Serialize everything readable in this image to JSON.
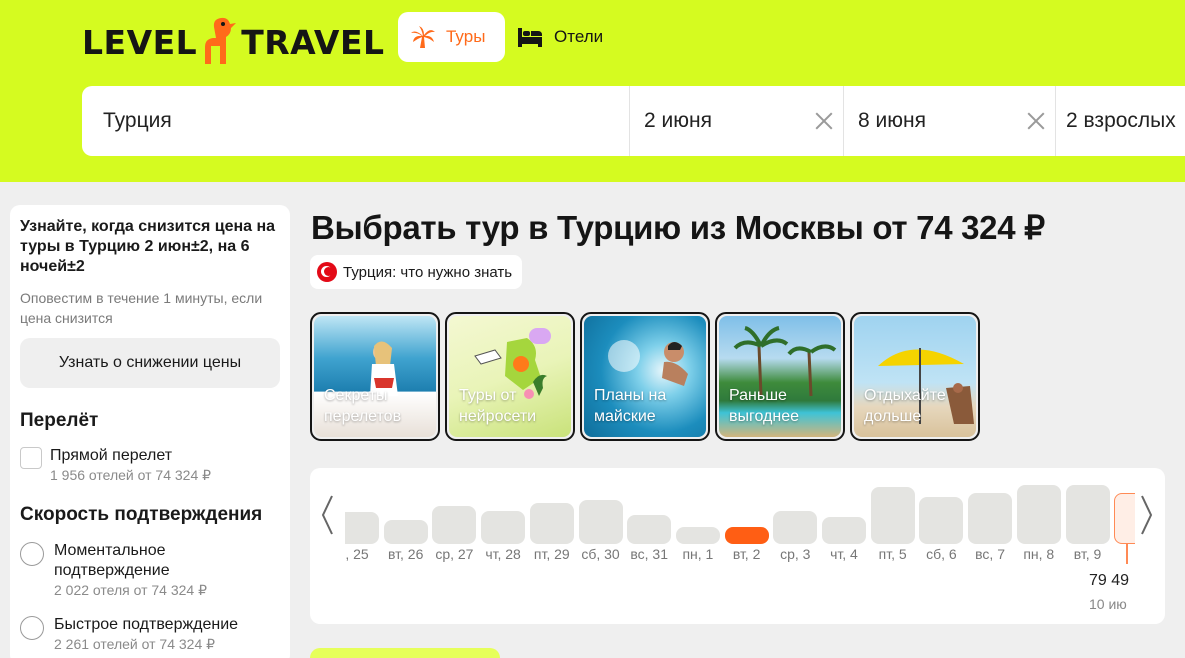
{
  "header": {
    "logo_left": "LEVEL",
    "logo_right": "TRAVEL",
    "tabs": [
      {
        "label": "Туры",
        "icon": "palm-icon",
        "active": true
      },
      {
        "label": "Отели",
        "icon": "bed-icon",
        "active": false
      }
    ]
  },
  "search": {
    "destination": "Турция",
    "date_from": "2 июня",
    "date_to": "8 июня",
    "guests": "2 взрослых"
  },
  "sidebar": {
    "alert_title": "Узнайте, когда снизится цена на туры в Турцию 2 июн±2, на 6 ночей±2",
    "alert_subtitle": "Оповестим в течение 1 минуты, если цена снизится",
    "notify_button": "Узнать о снижении цены",
    "flight": {
      "title": "Перелёт",
      "options": [
        {
          "label": "Прямой перелет",
          "count": "1 956 отелей от 74 324 ₽"
        }
      ]
    },
    "confirmation": {
      "title": "Скорость подтверждения",
      "options": [
        {
          "label": "Моментальное подтверждение",
          "count": "2 022 отеля от 74 324 ₽"
        },
        {
          "label": "Быстрое подтверждение",
          "count": "2 261 отелей от 74 324 ₽"
        }
      ]
    }
  },
  "main": {
    "title": "Выбрать тур в Турцию из Москвы от 74 324 ₽",
    "info_chip": "Турция: что нужно знать",
    "stories": [
      {
        "caption": "Секреты перелетов"
      },
      {
        "caption": "Туры от нейросети"
      },
      {
        "caption": "Планы на майские"
      },
      {
        "caption": "Раньше выгоднее"
      },
      {
        "caption": "Отдыхайте дольше"
      }
    ]
  },
  "calendar": {
    "days": [
      {
        "label": ", 25",
        "level": 0.42,
        "selected": false
      },
      {
        "label": "вт, 26",
        "level": 0.31,
        "selected": false
      },
      {
        "label": "ср, 27",
        "level": 0.5,
        "selected": false
      },
      {
        "label": "чт, 28",
        "level": 0.44,
        "selected": false
      },
      {
        "label": "пт, 29",
        "level": 0.54,
        "selected": false
      },
      {
        "label": "сб, 30",
        "level": 0.58,
        "selected": false
      },
      {
        "label": "вс, 31",
        "level": 0.38,
        "selected": false
      },
      {
        "label": "пн, 1",
        "level": 0.23,
        "selected": false
      },
      {
        "label": "вт, 2",
        "level": 0.23,
        "selected": true
      },
      {
        "label": "ср, 3",
        "level": 0.44,
        "selected": false
      },
      {
        "label": "чт, 4",
        "level": 0.36,
        "selected": false
      },
      {
        "label": "пт, 5",
        "level": 0.75,
        "selected": false
      },
      {
        "label": "сб, 6",
        "level": 0.62,
        "selected": false
      },
      {
        "label": "вс, 7",
        "level": 0.67,
        "selected": false
      },
      {
        "label": "пн, 8",
        "level": 0.78,
        "selected": false
      },
      {
        "label": "вт, 9",
        "level": 0.78,
        "selected": false
      },
      {
        "label": "",
        "level": 0.67,
        "selected": false,
        "partial": true
      }
    ],
    "hover_price": "79 49",
    "hover_date": "10 ию"
  }
}
